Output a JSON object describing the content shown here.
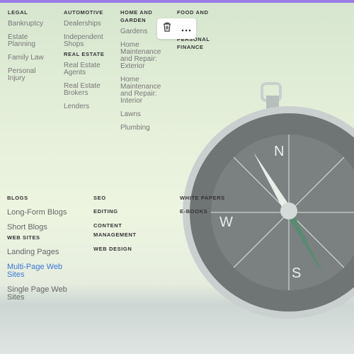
{
  "top_menu": [
    {
      "heading": "Legal",
      "items": [
        "Bankruptcy",
        "Estate Planning",
        "Family Law",
        "Personal Injury"
      ]
    },
    {
      "heading": "Automotive",
      "items": [
        "Dealerships",
        "Independent Shops"
      ],
      "heading2": "Real Estate",
      "items2": [
        "Real Estate Agents",
        "Real Estate Brokers",
        "Lenders"
      ]
    },
    {
      "heading": "Home and Garden",
      "items": [
        "Gardens",
        "Home Maintenance and Repair: Exterior",
        "Home Maintenance and Repair: Interior",
        "Lawns",
        "Plumbing"
      ]
    },
    {
      "heading": "Food and Wine",
      "heading2": "Personal Finance"
    }
  ],
  "bottom_menu": [
    {
      "heading": "Blogs",
      "items": [
        "Long-Form Blogs",
        "Short Blogs"
      ],
      "heading2": "Web Sites",
      "items2": [
        "Landing Pages",
        "Multi-Page Web Sites",
        "Single Page Web Sites"
      ]
    },
    {
      "headings": [
        "SEO",
        "Editing",
        "Content Management",
        "Web Design"
      ]
    },
    {
      "headings": [
        "White Papers",
        "E-Books"
      ]
    }
  ],
  "toolbar": {
    "delete_icon": "trash-icon",
    "more_icon": "more-horizontal-icon"
  },
  "colors": {
    "accent": "#9b7be6",
    "link": "#3a76d6"
  }
}
